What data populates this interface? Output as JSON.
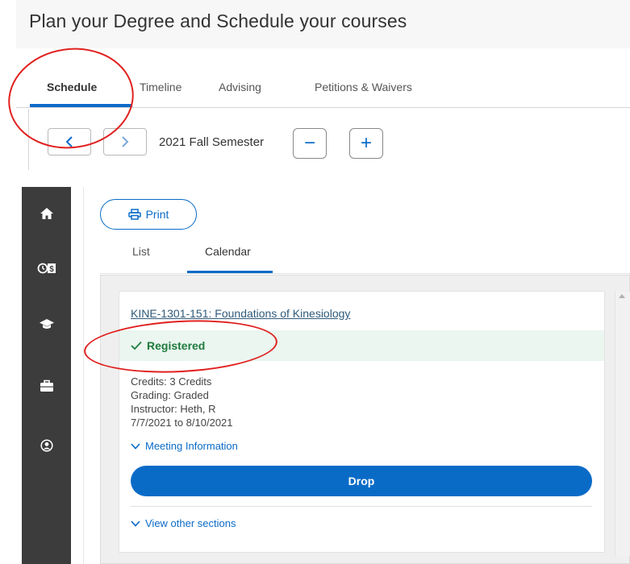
{
  "page": {
    "title": "Plan your Degree and Schedule your courses"
  },
  "tabs": [
    {
      "label": "Schedule"
    },
    {
      "label": "Timeline"
    },
    {
      "label": "Advising"
    },
    {
      "label": "Petitions & Waivers"
    }
  ],
  "semester": {
    "label": "2021 Fall Semester",
    "prev_icon": "chevron-left",
    "next_icon": "chevron-right",
    "collapse_label": "−",
    "expand_label": "+"
  },
  "sidebar": {
    "items": [
      {
        "icon": "home-icon"
      },
      {
        "icon": "clock-dollar-icon"
      },
      {
        "icon": "graduation-cap-icon"
      },
      {
        "icon": "briefcase-icon"
      },
      {
        "icon": "user-icon"
      }
    ]
  },
  "print": {
    "label": "Print"
  },
  "subtabs": [
    {
      "label": "List"
    },
    {
      "label": "Calendar"
    }
  ],
  "course": {
    "title": "KINE-1301-151: Foundations of Kinesiology",
    "status": "Registered",
    "credits": "Credits: 3 Credits",
    "grading": "Grading: Graded",
    "instructor": "Instructor: Heth, R",
    "dates": "7/7/2021 to 8/10/2021",
    "meeting_info": "Meeting Information",
    "drop_label": "Drop",
    "other_sections": "View other sections"
  },
  "colors": {
    "accent": "#0a6bc7",
    "status_green": "#1f7a3e",
    "status_bg": "#eaf6ef",
    "sidebar_bg": "#3c3c3c",
    "annotation": "#e0201f"
  }
}
